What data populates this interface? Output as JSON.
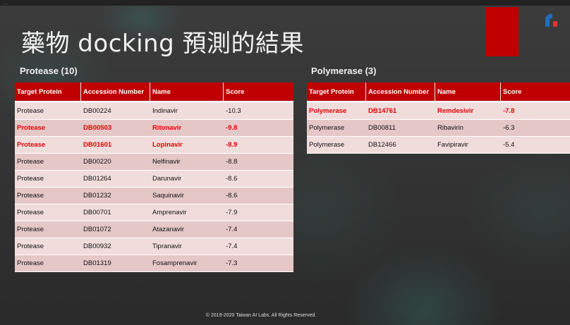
{
  "top_strip_text": "...",
  "slide_title": "藥物 docking 預測的結果",
  "protease_table": {
    "heading": "Protease (10)",
    "columns": [
      "Target Protein",
      "Accession Number",
      "Name",
      "Score"
    ],
    "rows": [
      {
        "target": "Protease",
        "accession": "DB00224",
        "name": "Indinavir",
        "score": "-10.3",
        "highlight": false
      },
      {
        "target": "Protease",
        "accession": "DB00503",
        "name": "Ritonavir",
        "score": "-9.8",
        "highlight": true
      },
      {
        "target": "Protease",
        "accession": "DB01601",
        "name": "Lopinavir",
        "score": "-8.9",
        "highlight": true
      },
      {
        "target": "Protease",
        "accession": "DB00220",
        "name": "Nelfinavir",
        "score": "-8.8",
        "highlight": false
      },
      {
        "target": "Protease",
        "accession": "DB01264",
        "name": "Darunavir",
        "score": "-8.6",
        "highlight": false
      },
      {
        "target": "Protease",
        "accession": "DB01232",
        "name": "Saquinavir",
        "score": "-8.6",
        "highlight": false
      },
      {
        "target": "Protease",
        "accession": "DB00701",
        "name": "Amprenavir",
        "score": "-7.9",
        "highlight": false
      },
      {
        "target": "Protease",
        "accession": "DB01072",
        "name": "Atazanavir",
        "score": "-7.4",
        "highlight": false
      },
      {
        "target": "Protease",
        "accession": "DB00932",
        "name": "Tipranavir",
        "score": "-7.4",
        "highlight": false
      },
      {
        "target": "Protease",
        "accession": "DB01319",
        "name": "Fosamprenavir",
        "score": "-7.3",
        "highlight": false
      }
    ]
  },
  "polymerase_table": {
    "heading": "Polymerase (3)",
    "columns": [
      "Target Protein",
      "Accession Number",
      "Name",
      "Score"
    ],
    "rows": [
      {
        "target": "Polymerase",
        "accession": "DB14761",
        "name": "Remdesivir",
        "score": "-7.8",
        "highlight": true
      },
      {
        "target": "Polymerase",
        "accession": "DB00811",
        "name": "Ribavirin",
        "score": "-6.3",
        "highlight": false
      },
      {
        "target": "Polymerase",
        "accession": "DB12466",
        "name": "Favipiravir",
        "score": "-5.4",
        "highlight": false
      }
    ]
  },
  "footer": "© 2019-2020 Taiwan AI Labs. All Rights Reserved.",
  "colors": {
    "accent": "#c00000",
    "highlight_text": "#e00000",
    "logo_blue": "#1d6fc4"
  },
  "icons": {
    "logo": "taiwan-ai-labs-logo-icon"
  }
}
